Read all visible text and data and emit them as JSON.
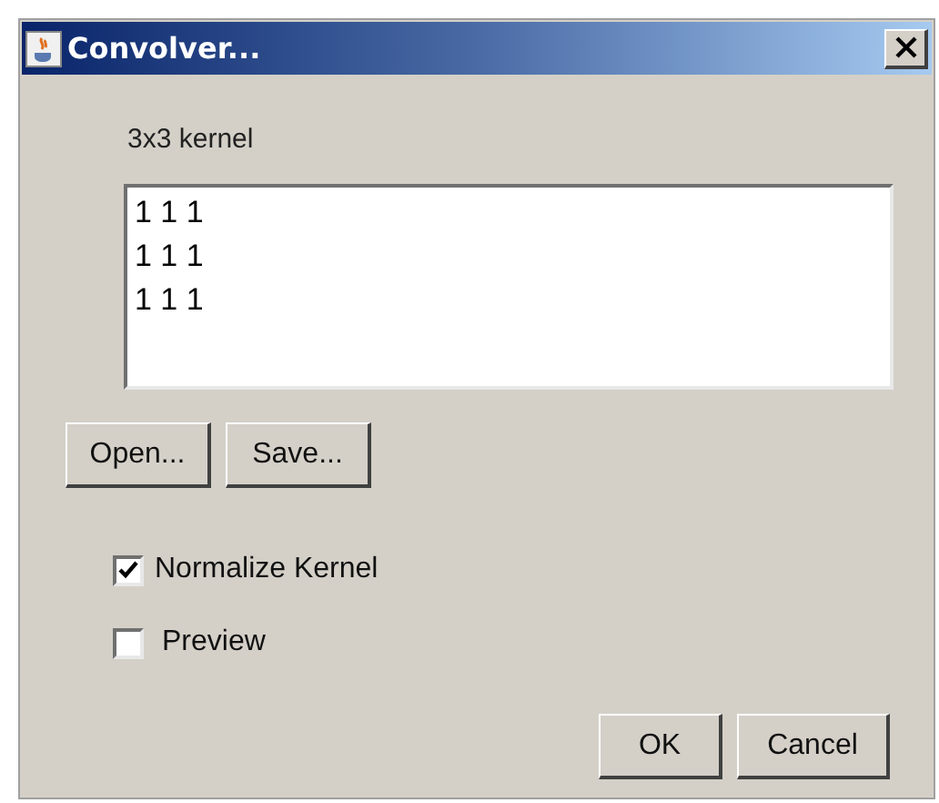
{
  "window": {
    "title": "Convolver..."
  },
  "kernel_label": "3x3 kernel",
  "kernel_lines": [
    "1 1 1",
    "1 1 1",
    "1 1 1"
  ],
  "file_buttons": [
    "Open...",
    "Save..."
  ],
  "options": [
    {
      "label": "Normalize Kernel",
      "checked": true
    },
    {
      "label": "Preview",
      "checked": false
    }
  ],
  "buttons": [
    "OK",
    "Cancel"
  ]
}
